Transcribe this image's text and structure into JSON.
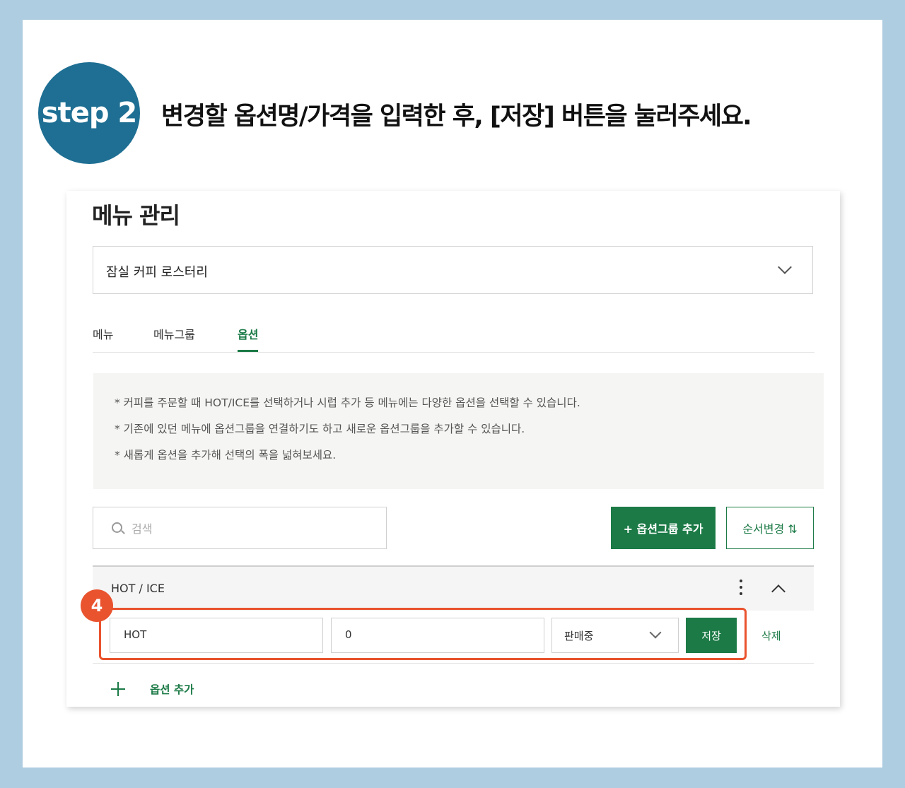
{
  "step": {
    "badge": "step 2",
    "title": "변경할 옵션명/가격을 입력한 후, [저장] 버튼을 눌러주세요."
  },
  "page": {
    "title": "메뉴 관리"
  },
  "store_select": {
    "value": "잠실 커피 로스터리"
  },
  "tabs": [
    {
      "label": "메뉴",
      "active": false
    },
    {
      "label": "메뉴그룹",
      "active": false
    },
    {
      "label": "옵션",
      "active": true
    }
  ],
  "info": [
    "* 커피를 주문할 때 HOT/ICE를 선택하거나 시럽 추가 등 메뉴에는 다양한 옵션을 선택할 수 있습니다.",
    "* 기존에 있던 메뉴에 옵션그룹을 연결하기도 하고 새로운 옵션그룹을 추가할 수 있습니다.",
    "* 새롭게 옵션을 추가해 선택의 폭을 넓혀보세요."
  ],
  "search": {
    "placeholder": "검색"
  },
  "toolbar": {
    "add_group_label": "+ 옵션그룹 추가",
    "reorder_label": "순서변경 ⇅"
  },
  "option_group": {
    "name": "HOT / ICE",
    "options": [
      {
        "name": "HOT",
        "price": "0",
        "status": "판매중",
        "save_label": "저장",
        "delete_label": "삭제"
      }
    ]
  },
  "annotation": {
    "number": "4"
  },
  "add_option": {
    "label": "옵션 추가"
  },
  "colors": {
    "background": "#aecde0",
    "badge": "#1e6f93",
    "primary_green": "#1b7a46",
    "highlight": "#e9532e"
  }
}
